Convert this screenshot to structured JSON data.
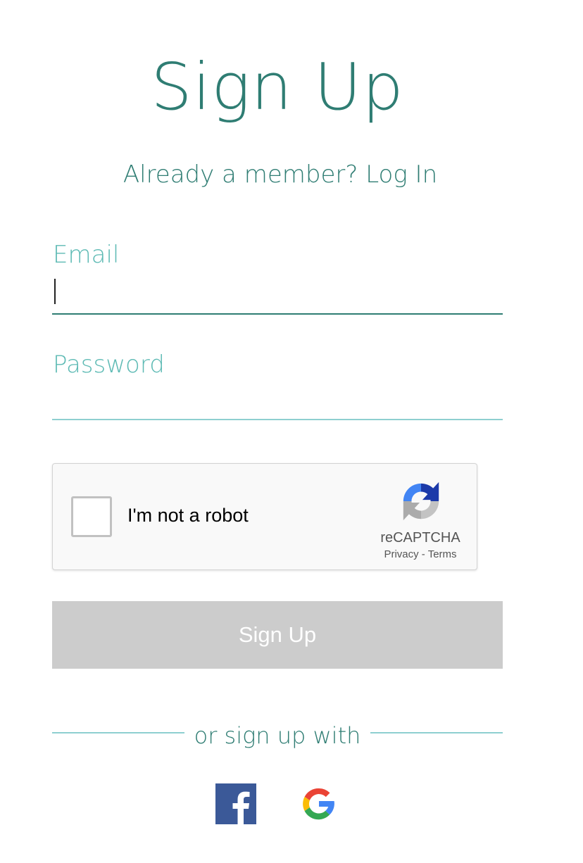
{
  "header": {
    "title": "Sign Up",
    "member_prompt": "Already a member?",
    "login_link": "Log In"
  },
  "form": {
    "email": {
      "label": "Email",
      "value": ""
    },
    "password": {
      "label": "Password",
      "value": ""
    }
  },
  "captcha": {
    "checkbox_label": "I'm not a robot",
    "brand": "reCAPTCHA",
    "privacy": "Privacy",
    "separator": "-",
    "terms": "Terms"
  },
  "submit": {
    "label": "Sign Up"
  },
  "social": {
    "divider_text": "or sign up with",
    "providers": [
      {
        "icon": "facebook-icon",
        "color": "#3b5998"
      },
      {
        "icon": "google-icon",
        "colors": [
          "#ea4335",
          "#fbbc05",
          "#34a853",
          "#4285f4"
        ]
      }
    ]
  },
  "colors": {
    "accent": "#2f7d73",
    "label": "#5dbab4",
    "divider": "#8ecfd0",
    "button_disabled": "#cccccc"
  }
}
